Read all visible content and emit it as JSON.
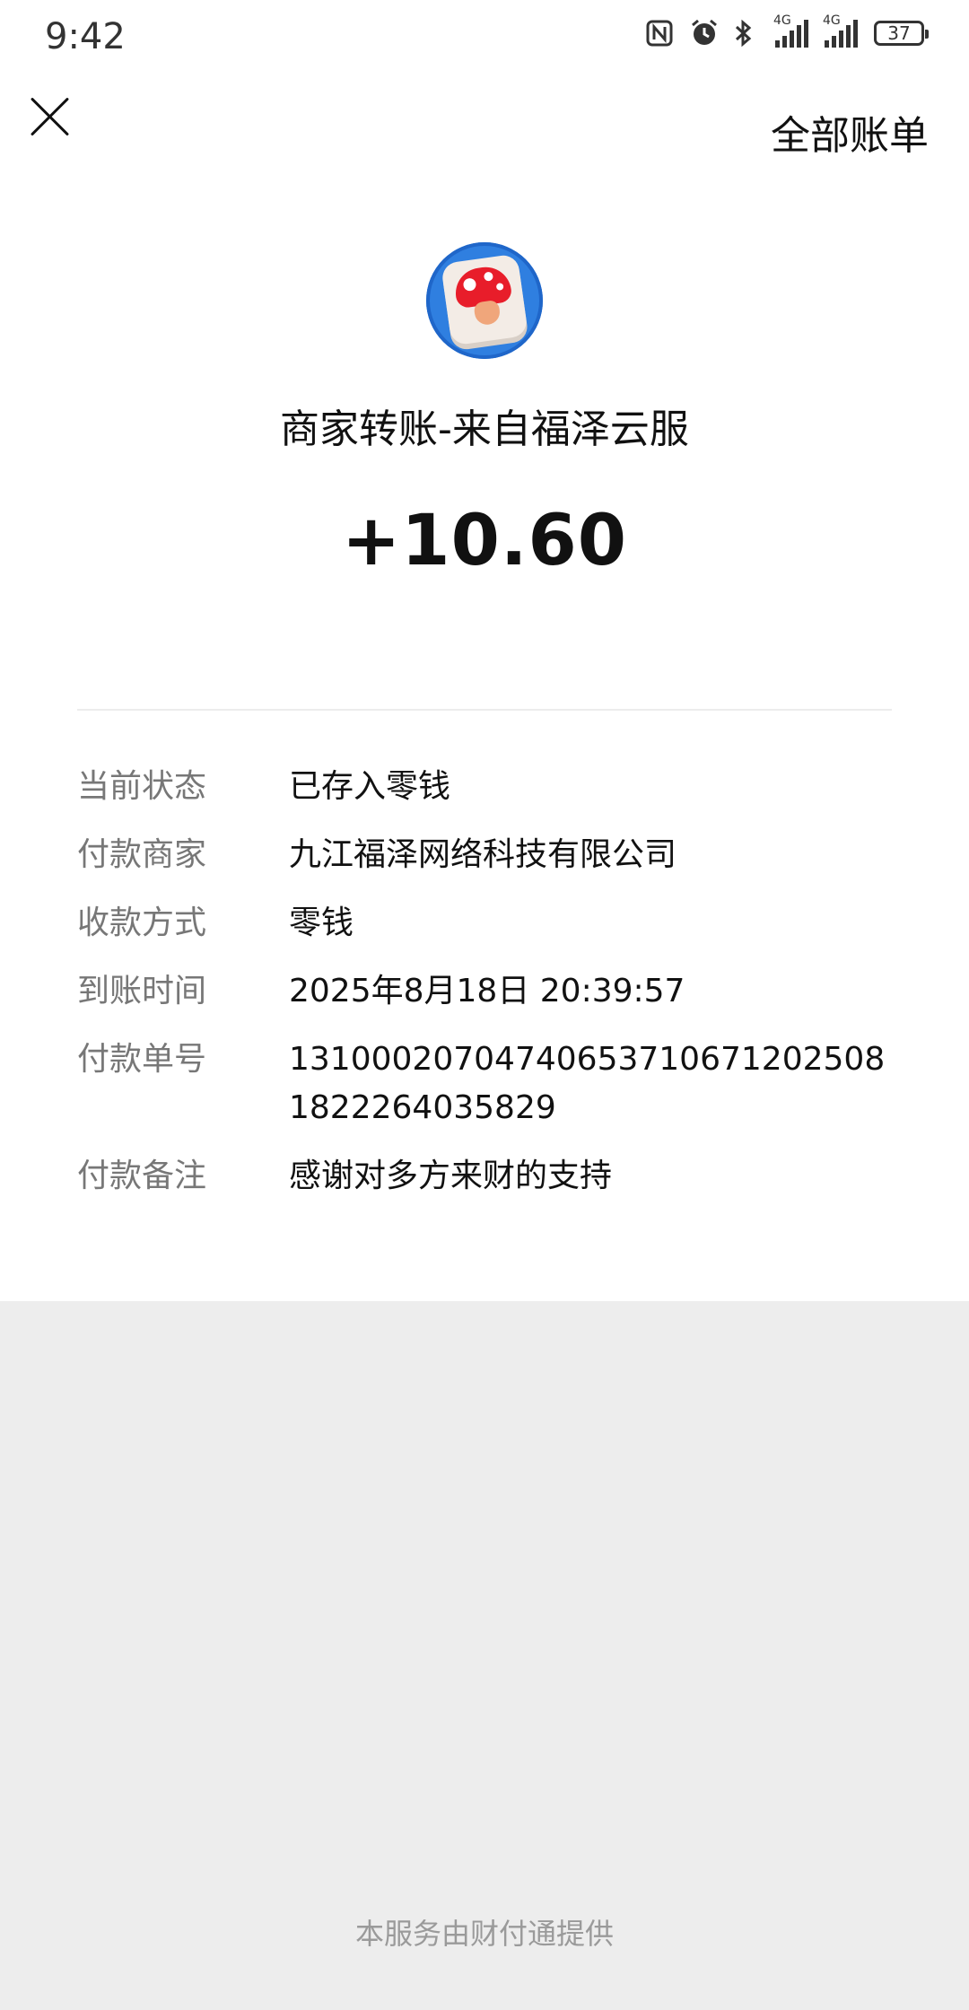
{
  "status": {
    "time": "9:42",
    "battery": "37",
    "signal_label": "4G"
  },
  "nav": {
    "all_bills_label": "全部账单"
  },
  "transaction": {
    "title": "商家转账-来自福泽云服",
    "amount": "+10.60"
  },
  "details": [
    {
      "label": "当前状态",
      "value": "已存入零钱"
    },
    {
      "label": "付款商家",
      "value": "九江福泽网络科技有限公司"
    },
    {
      "label": "收款方式",
      "value": "零钱"
    },
    {
      "label": "到账时间",
      "value": "2025年8月18日 20:39:57"
    },
    {
      "label": "付款单号",
      "value": "131000207047406537106712025081822264035829"
    },
    {
      "label": "付款备注",
      "value": "感谢对多方来财的支持"
    }
  ],
  "footer": {
    "text": "本服务由财付通提供"
  }
}
